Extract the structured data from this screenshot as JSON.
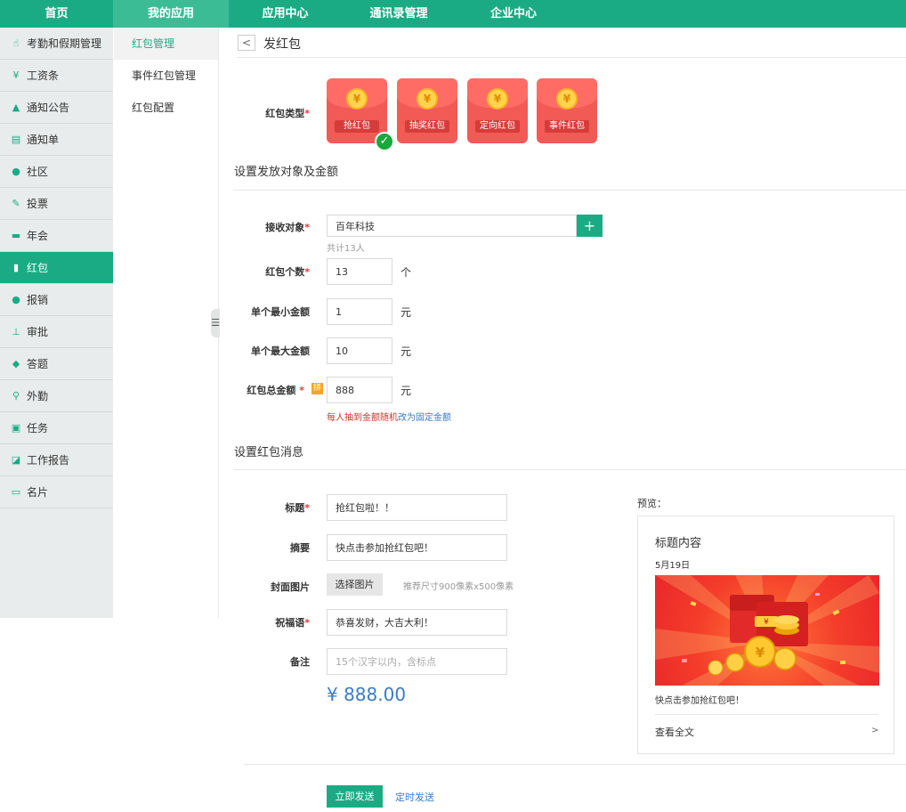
{
  "topnav": [
    "首页",
    "我的应用",
    "应用中心",
    "通讯录管理",
    "企业中心"
  ],
  "sidebar": [
    {
      "label": "考勤和假期管理",
      "icon": "attendance-icon"
    },
    {
      "label": "工资条",
      "icon": "salary-icon"
    },
    {
      "label": "通知公告",
      "icon": "bell-icon"
    },
    {
      "label": "通知单",
      "icon": "notice-icon"
    },
    {
      "label": "社区",
      "icon": "chat-icon"
    },
    {
      "label": "投票",
      "icon": "vote-icon"
    },
    {
      "label": "年会",
      "icon": "calendar-icon"
    },
    {
      "label": "红包",
      "icon": "red-packet-icon"
    },
    {
      "label": "报销",
      "icon": "reimburse-icon"
    },
    {
      "label": "审批",
      "icon": "approval-icon"
    },
    {
      "label": "答题",
      "icon": "quiz-icon"
    },
    {
      "label": "外勤",
      "icon": "location-icon"
    },
    {
      "label": "任务",
      "icon": "task-icon"
    },
    {
      "label": "工作报告",
      "icon": "report-icon"
    },
    {
      "label": "名片",
      "icon": "card-icon"
    }
  ],
  "submenu": [
    "红包管理",
    "事件红包管理",
    "红包配置"
  ],
  "page": {
    "title": "发红包",
    "back": "<"
  },
  "type": {
    "label": "红包类型",
    "options": [
      "抢红包",
      "抽奖红包",
      "定向红包",
      "事件红包"
    ],
    "coin": "¥",
    "check": "✓"
  },
  "section1": "设置发放对象及金额",
  "receiver": {
    "label": "接收对象",
    "value": "百年科技",
    "count": "共计13人",
    "add": "+"
  },
  "num": {
    "label": "红包个数",
    "value": "13",
    "unit": "个"
  },
  "min": {
    "label": "单个最小金额",
    "value": "1",
    "unit": "元"
  },
  "max": {
    "label": "单个最大金额",
    "value": "10",
    "unit": "元"
  },
  "total": {
    "label": "红包总金额",
    "badge": "拼",
    "value": "888",
    "unit": "元"
  },
  "random_note": {
    "text": "每人抽到金额随机",
    "link": "改为固定金额"
  },
  "section2": "设置红包消息",
  "msg_title": {
    "label": "标题",
    "value": "抢红包啦！！"
  },
  "summary": {
    "label": "摘要",
    "value": "快点击参加抢红包吧！"
  },
  "cover": {
    "label": "封面图片",
    "button": "选择图片",
    "hint": "推荐尺寸900像素x500像素"
  },
  "blessing": {
    "label": "祝福语",
    "value": "恭喜发财，大吉大利！"
  },
  "remark": {
    "label": "备注",
    "placeholder": "15个汉字以内，含标点"
  },
  "amount": "¥ 888.00",
  "preview": {
    "label": "预览：",
    "title": "标题内容",
    "date": "5月19日",
    "summary": "快点击参加抢红包吧！",
    "read_all": "查看全文",
    "arrow": ">"
  },
  "footer": {
    "send_now": "立即发送",
    "schedule": "定时发送"
  },
  "colors": {
    "brand": "#1bab84",
    "red_packet": "#f25a56",
    "link": "#3a7bc8",
    "warn": "#c0392b"
  }
}
